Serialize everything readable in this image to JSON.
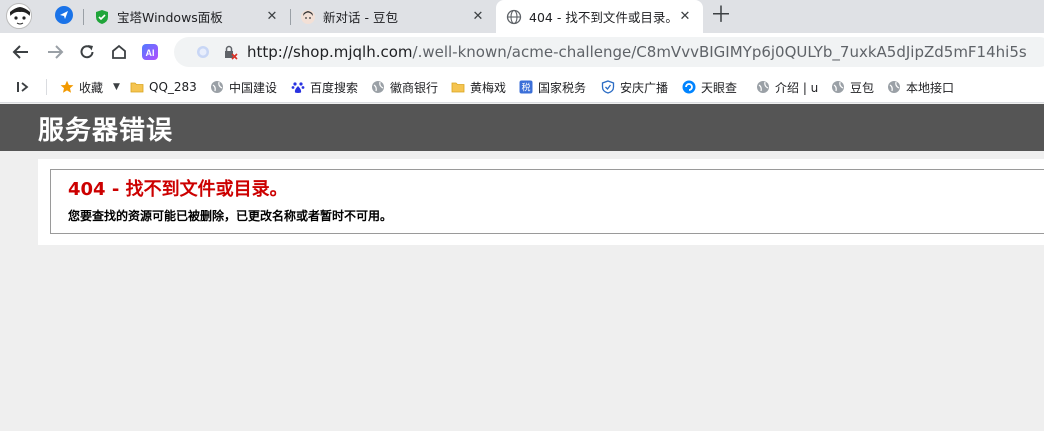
{
  "tabs": [
    {
      "title": "宝塔Windows面板",
      "icon": "shield-icon",
      "active": false
    },
    {
      "title": "新对话 - 豆包",
      "icon": "doubao-icon",
      "active": false
    },
    {
      "title": "404 - 找不到文件或目录。",
      "icon": "globe-icon",
      "active": true
    }
  ],
  "toolbar": {
    "url_host": "http://shop.mjqlh.com",
    "url_path": "/.well-known/acme-challenge/C8mVvvBIGIMYp6j0QULYb_7uxkA5dJipZd5mF14hi5s"
  },
  "bookmarks": [
    {
      "label": "收藏",
      "icon": "star-icon"
    },
    {
      "label": "QQ_283",
      "icon": "folder-icon"
    },
    {
      "label": "中国建设",
      "icon": "globe-icon"
    },
    {
      "label": "百度搜索",
      "icon": "baidu-icon"
    },
    {
      "label": "徽商银行",
      "icon": "globe-icon"
    },
    {
      "label": "黄梅戏",
      "icon": "folder-icon"
    },
    {
      "label": "国家税务",
      "icon": "tax-icon"
    },
    {
      "label": "安庆广播",
      "icon": "shield-check-icon"
    },
    {
      "label": "天眼查",
      "icon": "tianyancha-icon"
    },
    {
      "label": "介绍 | u",
      "icon": "globe-icon"
    },
    {
      "label": "豆包",
      "icon": "globe-icon"
    },
    {
      "label": "本地接口",
      "icon": "globe-icon"
    }
  ],
  "page": {
    "header_title": "服务器错误",
    "error_heading": "404 - 找不到文件或目录。",
    "error_message": "您要查找的资源可能已被删除，已更改名称或者暂时不可用。"
  },
  "colors": {
    "header_bg": "#555555",
    "error_red": "#cc0000",
    "page_bg": "#efefef"
  }
}
